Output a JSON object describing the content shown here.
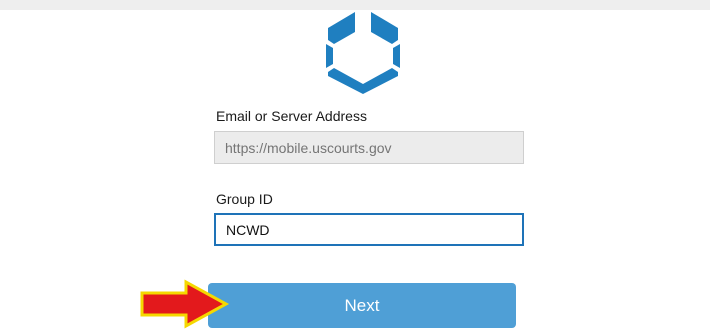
{
  "form": {
    "server_label": "Email or Server Address",
    "server_placeholder": "https://mobile.uscourts.gov",
    "server_value": "",
    "group_label": "Group ID",
    "group_value": "NCWD",
    "next_label": "Next"
  },
  "colors": {
    "logo_blue": "#1f7fc0",
    "button_blue": "#4f9fd6",
    "focus_border": "#1e73b8",
    "annotation_arrow_fill": "#e3191c",
    "annotation_arrow_outline": "#f5d800"
  },
  "icons": {
    "logo": "hexagonal-app-logo-icon",
    "annotation": "red-arrow-pointer-icon"
  }
}
